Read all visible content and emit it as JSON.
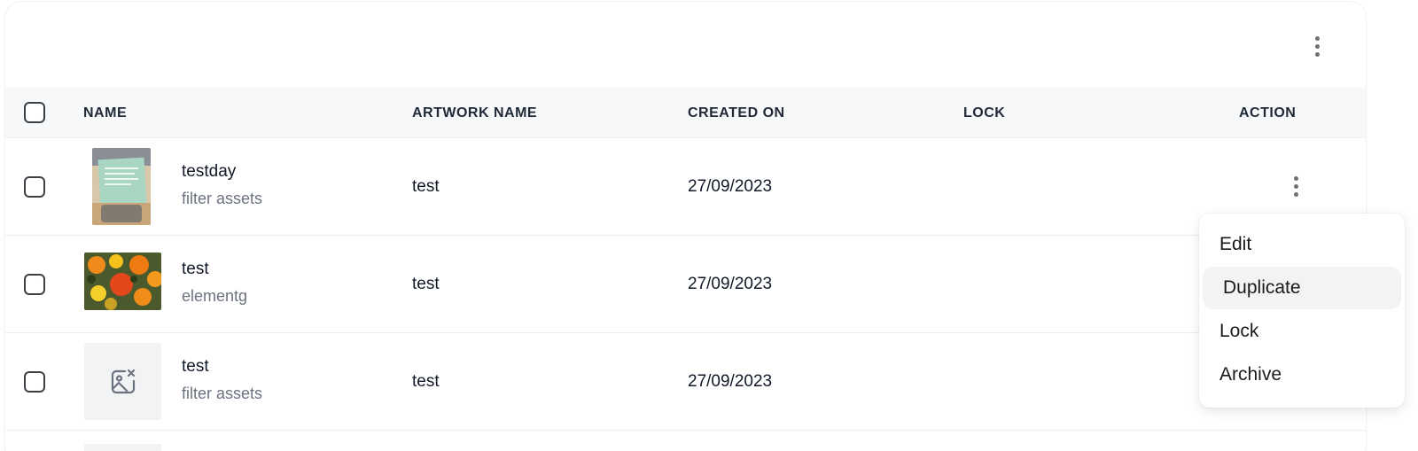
{
  "table": {
    "columns": {
      "name": "NAME",
      "artwork_name": "ARTWORK NAME",
      "created_on": "CREATED ON",
      "lock": "LOCK",
      "action": "ACTION"
    },
    "rows": [
      {
        "name": "testday",
        "subtitle": "filter assets",
        "artwork_name": "test",
        "created_on": "27/09/2023",
        "lock": ""
      },
      {
        "name": "test",
        "subtitle": "elementg",
        "artwork_name": "test",
        "created_on": "27/09/2023",
        "lock": ""
      },
      {
        "name": "test",
        "subtitle": "filter assets",
        "artwork_name": "test",
        "created_on": "27/09/2023",
        "lock": ""
      }
    ]
  },
  "action_menu": {
    "items": [
      "Edit",
      "Duplicate",
      "Lock",
      "Archive"
    ],
    "highlighted": "Duplicate"
  },
  "icons": {
    "toolbar_menu": "more-vertical-icon",
    "row_menu": "more-vertical-icon",
    "missing_image": "image-off-icon"
  },
  "colors": {
    "header_bg": "#f7f8fa",
    "menu_highlight": "#f2f3f5",
    "subtitle_text": "#6b7280"
  }
}
